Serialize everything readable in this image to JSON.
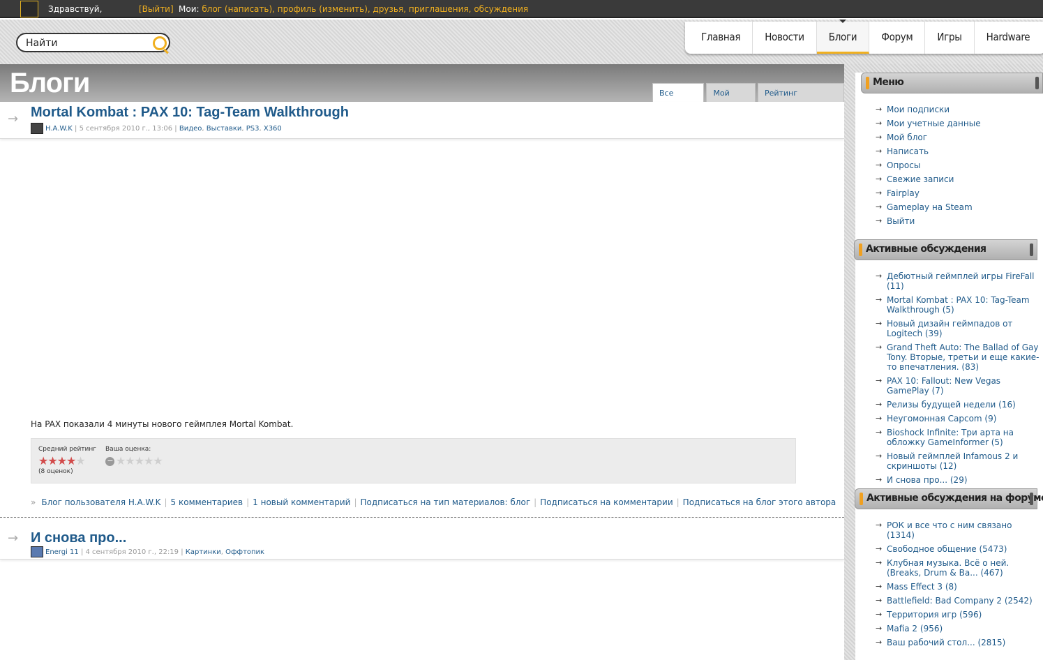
{
  "topbar": {
    "greeting": "Здравствуй,",
    "logout": "[Выйти]",
    "mine_label": "Мои:",
    "blog": "блог",
    "write": "написать",
    "profile": "профиль",
    "edit": "изменить",
    "friends": "друзья",
    "invites": "приглашения",
    "discussions": "обсуждения"
  },
  "search": {
    "placeholder": "Найти",
    "value": "Найти"
  },
  "nav": [
    {
      "label": "Главная"
    },
    {
      "label": "Новости"
    },
    {
      "label": "Блоги",
      "active": true
    },
    {
      "label": "Форум"
    },
    {
      "label": "Игры"
    },
    {
      "label": "Hardware"
    }
  ],
  "page": {
    "title": "Блоги",
    "tabs": [
      "Все блоги",
      "Мой блог",
      "Рейтинг блоггеров"
    ]
  },
  "posts": [
    {
      "title": "Mortal Kombat : PAX 10: Tag-Team Walkthrough",
      "author": "H.A.W.K",
      "date": "5 сентября 2010 г., 13:06",
      "tags": [
        "Видео",
        "Выставки",
        "PS3",
        "X360"
      ],
      "text": "На PAX показали 4 минуты нового геймплея Mortal Kombat.",
      "rating": {
        "avg_label": "Средний рейтинг",
        "your_label": "Ваша оценка:",
        "avg_value": 4,
        "max": 5,
        "count": "(8 оценок)"
      },
      "links": [
        "Блог пользователя H.A.W.K",
        "5 комментариев",
        "1 новый комментарий",
        "Подписаться на тип материалов: блог",
        "Подписаться на комментарии",
        "Подписаться на блог этого автора"
      ]
    },
    {
      "title": "И снова про...",
      "author": "Energi 11",
      "date": "4 сентября 2010 г., 22:19",
      "tags": [
        "Картинки",
        "Оффтопик"
      ]
    }
  ],
  "sidebar": {
    "menu": {
      "title": "Меню",
      "items": [
        "Мои подписки",
        "Мои учетные данные",
        "Мой блог",
        "Написать",
        "Опросы",
        "Свежие записи",
        "Fairplay",
        "Gameplay на Steam",
        "Выйти"
      ]
    },
    "active": {
      "title": "Активные обсуждения",
      "items": [
        "Дебютный геймплей игры FireFall (11)",
        "Mortal Kombat : PAX 10: Tag-Team Walkthrough (5)",
        "Новый дизайн геймпадов от Logitech (39)",
        "Grand Theft Auto: The Ballad of Gay Tony. Вторые, третьи и еще какие-то впечатления. (83)",
        "PAX 10: Fallout: New Vegas GamePlay (7)",
        "Релизы будущей недели (16)",
        "Неугомонная Capcom (9)",
        "Bioshock Infinite: Три арта на обложку GameInformer (5)",
        "Новый геймплей Infamous 2 и скриншоты (12)",
        "И снова про... (29)"
      ]
    },
    "forum": {
      "title": "Активные обсуждения на форуме",
      "items": [
        "РОК и все что с ним связано (1314)",
        "Свободное общение (5473)",
        "Клубная музыка. Всё о ней. (Breaks, Drum & Ba... (467)",
        "Mass Effect 3 (8)",
        "Battlefield: Bad Company 2 (2542)",
        "Территория игр (596)",
        "Mafia 2 (956)",
        "Ваш рабочий стол... (2815)"
      ]
    }
  }
}
